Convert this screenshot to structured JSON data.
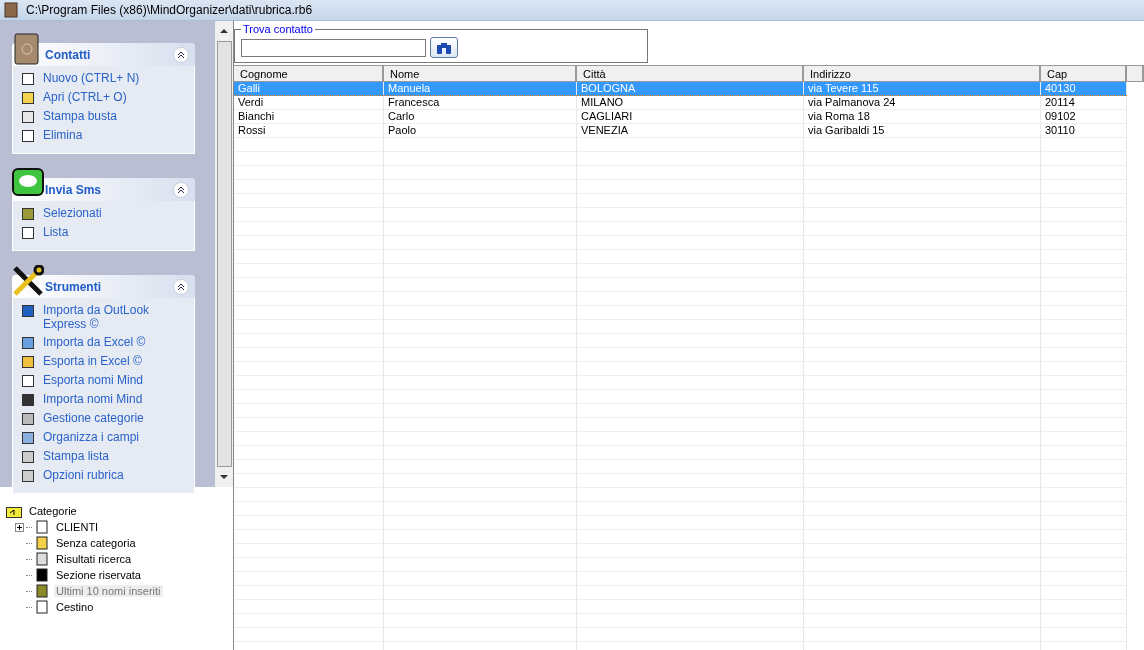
{
  "window": {
    "title": "C:\\Program Files (x86)\\MindOrganizer\\dati\\rubrica.rb6"
  },
  "sidebar": {
    "sections": [
      {
        "title": "Contatti",
        "expanded": true,
        "items": [
          "Nuovo (CTRL+ N)",
          "Apri (CTRL+ O)",
          "Stampa busta",
          "Elimina"
        ]
      },
      {
        "title": "Invia Sms",
        "expanded": true,
        "items": [
          "Selezionati",
          "Lista"
        ]
      },
      {
        "title": "Strumenti",
        "expanded": true,
        "items": [
          "Importa da OutLook Express ©",
          "Importa da Excel ©",
          "Esporta in Excel ©",
          "Esporta nomi Mind",
          "Importa nomi Mind",
          "Gestione categorie",
          "Organizza i campi",
          "Stampa lista",
          "Opzioni rubrica"
        ]
      }
    ]
  },
  "categories": {
    "label": "Categorie",
    "children": [
      {
        "label": "CLIENTI",
        "expanded": false,
        "selected": false
      },
      {
        "label": "Senza categoria",
        "selected": false
      },
      {
        "label": "Risultati ricerca",
        "selected": false
      },
      {
        "label": "Sezione riservata",
        "selected": false
      },
      {
        "label": "Ultimi 10 nomi inseriti",
        "selected": true
      },
      {
        "label": "Cestino",
        "selected": false
      }
    ]
  },
  "search": {
    "legend": "Trova contatto"
  },
  "table": {
    "columns": [
      "Cognome",
      "Nome",
      "Città",
      "Indirizzo",
      "Cap"
    ],
    "rows": [
      {
        "cells": [
          "Galli",
          "Manuela",
          "BOLOGNA",
          "via Tevere 115",
          "40130"
        ],
        "selected": true
      },
      {
        "cells": [
          "Verdi",
          "Francesca",
          "MILANO",
          "via Palmanova 24",
          "20114"
        ],
        "selected": false
      },
      {
        "cells": [
          "Bianchi",
          "Carlo",
          "CAGLIARI",
          "via Roma 18",
          "09102"
        ],
        "selected": false
      },
      {
        "cells": [
          "Rossi",
          "Paolo",
          "VENEZIA",
          "via Garibaldi 15",
          "30110"
        ],
        "selected": false
      }
    ]
  }
}
